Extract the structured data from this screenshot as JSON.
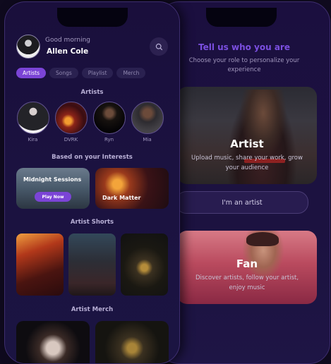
{
  "role_screen": {
    "title": "Tell us who you are",
    "subtitle": "Choose your role to personalize your experience",
    "artist_card": {
      "label": "Artist",
      "description": "Upload music, share your work, grow your audience",
      "button": "I'm an artist"
    },
    "fan_card": {
      "label": "Fan",
      "description": "Discover artists, follow your artist, enjoy music"
    }
  },
  "home_screen": {
    "greeting": "Good morning",
    "username": "Allen Cole",
    "search_icon": "search-icon",
    "tabs": [
      {
        "label": "Artists",
        "active": true
      },
      {
        "label": "Songs",
        "active": false
      },
      {
        "label": "Playlist",
        "active": false
      },
      {
        "label": "Merch",
        "active": false
      }
    ],
    "artists_section_title": "Artists",
    "artists": [
      {
        "name": "Kira"
      },
      {
        "name": "DVRK"
      },
      {
        "name": "Ryn"
      },
      {
        "name": "Mia"
      }
    ],
    "interests_section_title": "Based on your Interests",
    "interests": [
      {
        "title": "Midnight Sessions",
        "action": "Play Now"
      },
      {
        "title": "Dark Matter"
      }
    ],
    "shorts_section_title": "Artist Shorts",
    "merch_section_title": "Artist Merch"
  },
  "colors": {
    "accent": "#7b44d6",
    "background": "#1a0f3c",
    "title_purple": "#7b4fe0"
  }
}
